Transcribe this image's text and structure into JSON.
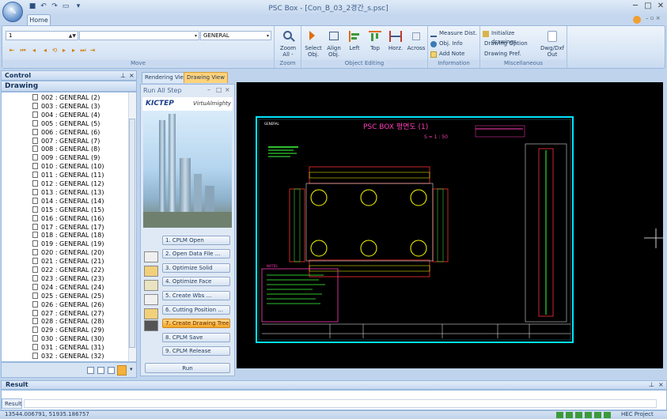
{
  "window": {
    "title": "PSC Box - [Con_B_03_2경간_s.psc]",
    "tab_home": "Home"
  },
  "ribbon": {
    "move": {
      "label": "Move",
      "combo_value": "1",
      "general_value": "GENERAL"
    },
    "zoom": {
      "label": "Zoom",
      "zoom_all": "Zoom\nAll -"
    },
    "object_editing": {
      "label": "Object Editing",
      "buttons": [
        "Select\nObj.",
        "Align\nObj.",
        "Left",
        "Top",
        "Horz.",
        "Across"
      ]
    },
    "information": {
      "label": "Information",
      "items": [
        "Measure Dist.",
        "Obj. Info",
        "Add Note"
      ]
    },
    "misc": {
      "label": "Miscellaneous",
      "items": [
        "Initialize drawings",
        "Drawing Option",
        "Drawing Pref."
      ],
      "dwg": "Dwg/Dxf\nOut"
    }
  },
  "control": {
    "title": "Control",
    "drawing_header": "Drawing"
  },
  "tree_items": [
    "002 : GENERAL (2)",
    "003 : GENERAL (3)",
    "004 : GENERAL (4)",
    "005 : GENERAL (5)",
    "006 : GENERAL (6)",
    "007 : GENERAL (7)",
    "008 : GENERAL (8)",
    "009 : GENERAL (9)",
    "010 : GENERAL (10)",
    "011 : GENERAL (11)",
    "012 : GENERAL (12)",
    "013 : GENERAL (13)",
    "014 : GENERAL (14)",
    "015 : GENERAL (15)",
    "016 : GENERAL (16)",
    "017 : GENERAL (17)",
    "018 : GENERAL (18)",
    "019 : GENERAL (19)",
    "020 : GENERAL (20)",
    "021 : GENERAL (21)",
    "022 : GENERAL (22)",
    "023 : GENERAL (23)",
    "024 : GENERAL (24)",
    "025 : GENERAL (25)",
    "026 : GENERAL (26)",
    "027 : GENERAL (27)",
    "028 : GENERAL (28)",
    "029 : GENERAL (29)",
    "030 : GENERAL (30)",
    "031 : GENERAL (31)",
    "032 : GENERAL (32)"
  ],
  "view_tabs": [
    "Rendering View",
    "Drawing View"
  ],
  "run_panel": {
    "title": "Run All Step",
    "logo1": "KICTEP",
    "logo2": "VirtuAlmighty",
    "steps": [
      "1. CPLM Open",
      "2. Open Data File ...",
      "3. Optimize Solid",
      "4. Optimize Face",
      "5. Create Wbs ...",
      "6. Cutting Position ...",
      "7. Create Drawing Tree",
      "8. CPLM Save",
      "9. CPLM Release"
    ],
    "run": "Run"
  },
  "drawing": {
    "title": "PSC BOX 평면도 (1)",
    "scale": "S = 1 : 50",
    "notes": "NOTES",
    "general": "GENERAL"
  },
  "result": {
    "header": "Result",
    "tab": "Result"
  },
  "status": {
    "coords": "13544.006791,  51935.186757",
    "project": "HEC Project"
  }
}
